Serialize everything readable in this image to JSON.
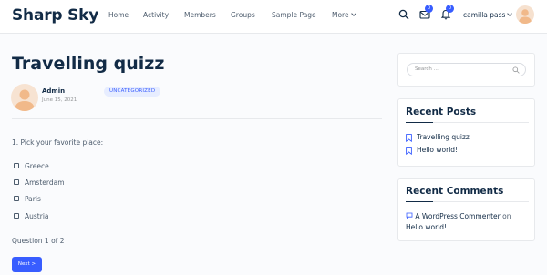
{
  "site": {
    "name": "Sharp Sky"
  },
  "nav": {
    "items": [
      "Home",
      "Activity",
      "Members",
      "Groups",
      "Sample Page",
      "More"
    ]
  },
  "header": {
    "messages_count": "0",
    "notifications_count": "0",
    "username": "camilla pass",
    "icons": [
      "search-icon",
      "inbox-icon",
      "bell-icon"
    ]
  },
  "post": {
    "title": "Travelling quizz",
    "author": "Admin",
    "date": "June 15, 2021",
    "category": "UNCATEGORIZED"
  },
  "quiz": {
    "question": "1. Pick your favorite place:",
    "options": [
      "Greece",
      "Amsterdam",
      "Paris",
      "Austria"
    ],
    "progress_text": "Question 1 of 2",
    "next_label": "Next >"
  },
  "sidebar": {
    "search_placeholder": "Search ...",
    "recent_posts_title": "Recent Posts",
    "recent_posts": [
      "Travelling quizz",
      "Hello world!"
    ],
    "recent_comments_title": "Recent Comments",
    "comment": {
      "author": "A WordPress Commenter",
      "on": "on",
      "post": "Hello world!"
    }
  },
  "colors": {
    "accent": "#385dff",
    "heading": "#122b46",
    "text": "#4d5c6d"
  }
}
